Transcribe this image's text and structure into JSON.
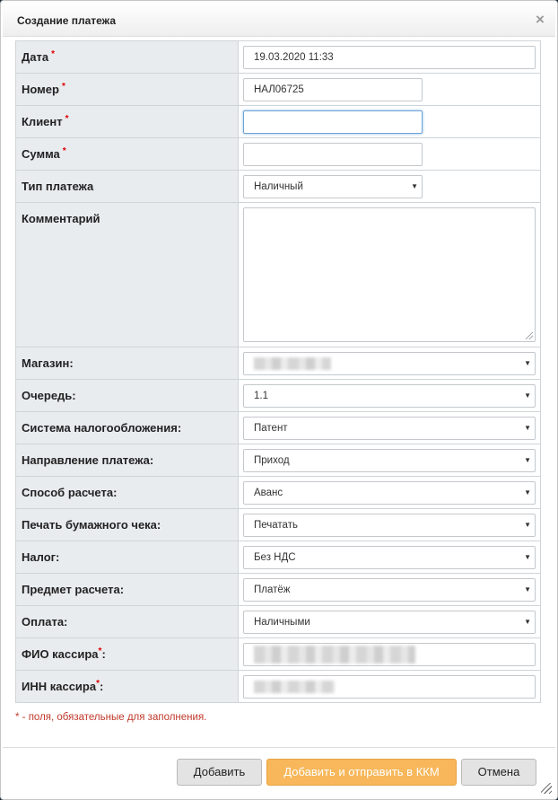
{
  "dialog": {
    "title": "Создание платежа",
    "close_glyph": "×"
  },
  "required_mark": "*",
  "fields": {
    "date": {
      "label": "Дата",
      "value": "19.03.2020 11:33"
    },
    "number": {
      "label": "Номер",
      "value": "НАЛ06725"
    },
    "client": {
      "label": "Клиент",
      "value": ""
    },
    "sum": {
      "label": "Сумма",
      "value": ""
    },
    "payment_type": {
      "label": "Тип платежа",
      "value": "Наличный"
    },
    "comment": {
      "label": "Комментарий",
      "value": ""
    },
    "shop": {
      "label": "Магазин:",
      "value": ""
    },
    "queue": {
      "label": "Очередь:",
      "value": "1.1"
    },
    "tax_system": {
      "label": "Система налогообложения:",
      "value": "Патент"
    },
    "direction": {
      "label": "Направление платежа:",
      "value": "Приход"
    },
    "calc_method": {
      "label": "Способ расчета:",
      "value": "Аванс"
    },
    "print_receipt": {
      "label": "Печать бумажного чека:",
      "value": "Печатать"
    },
    "tax": {
      "label": "Налог:",
      "value": "Без НДС"
    },
    "calc_subject": {
      "label": "Предмет расчета:",
      "value": "Платёж"
    },
    "payment": {
      "label": "Оплата:",
      "value": "Наличными"
    },
    "cashier_name": {
      "label": "ФИО кассира",
      "label_suffix": ":"
    },
    "cashier_inn": {
      "label": "ИНН кассира",
      "label_suffix": ":"
    }
  },
  "note": "* - поля, обязательные для заполнения.",
  "buttons": {
    "add": "Добавить",
    "add_send": "Добавить и отправить в ККМ",
    "cancel": "Отмена"
  },
  "colors": {
    "label_bg": "#e9ecef",
    "required": "#dd0000",
    "primary_button": "#f7b75a"
  }
}
